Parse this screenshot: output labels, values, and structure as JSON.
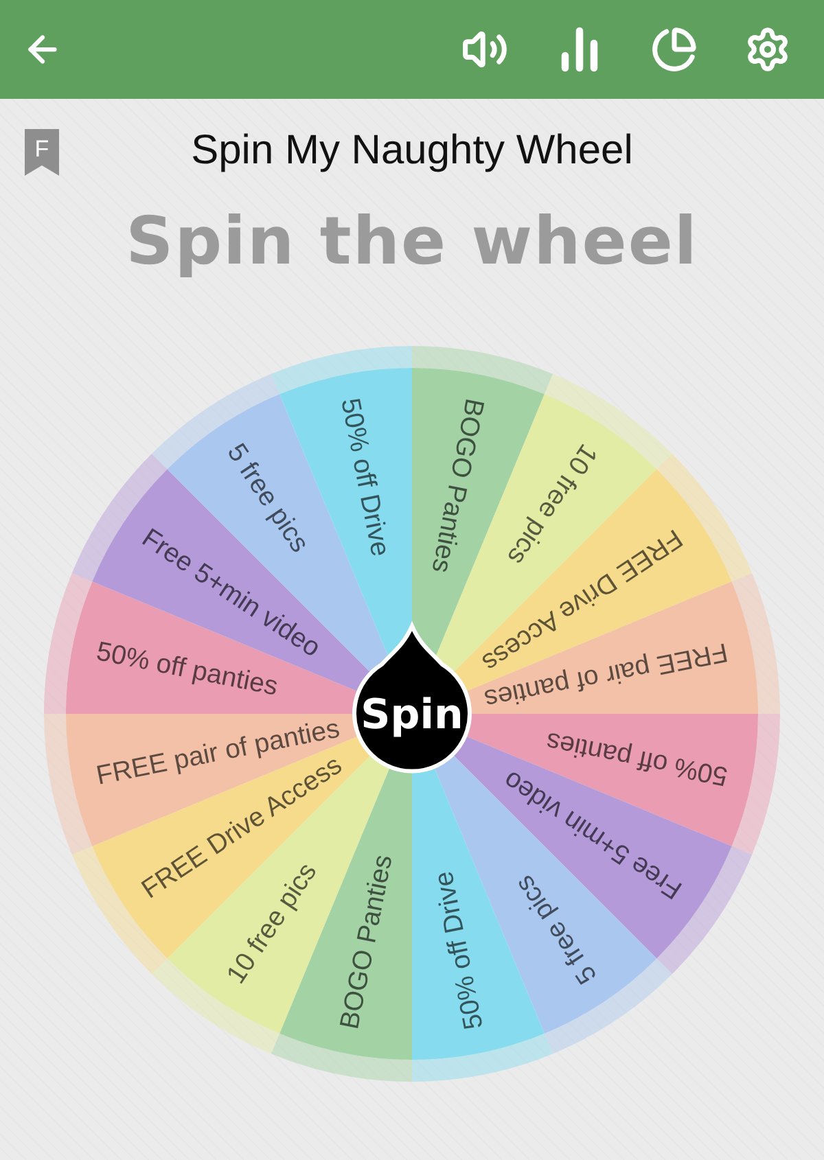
{
  "title": "Spin My Naughty Wheel",
  "badge": "F",
  "heading": "Spin the wheel",
  "spin_button": "Spin",
  "segments": [
    {
      "label": "BOGO Panties",
      "color": "#a3d3a5"
    },
    {
      "label": "10 free pics",
      "color": "#e3eca4"
    },
    {
      "label": "FREE Drive Access",
      "color": "#f6db8c"
    },
    {
      "label": "FREE pair of panties",
      "color": "#f2c1a8"
    },
    {
      "label": "50% off panties",
      "color": "#e99cb2"
    },
    {
      "label": "Free 5+min video",
      "color": "#b49ad9"
    },
    {
      "label": "5 free pics",
      "color": "#a9c7ef"
    },
    {
      "label": "50% off Drive",
      "color": "#86dcee"
    },
    {
      "label": "BOGO Panties",
      "color": "#a3d3a5"
    },
    {
      "label": "10 free pics",
      "color": "#e3eca4"
    },
    {
      "label": "FREE Drive Access",
      "color": "#f6db8c"
    },
    {
      "label": "FREE pair of panties",
      "color": "#f2c1a8"
    },
    {
      "label": "50% off panties",
      "color": "#e99cb2"
    },
    {
      "label": "Free 5+min video",
      "color": "#b49ad9"
    },
    {
      "label": "5 free pics",
      "color": "#a9c7ef"
    },
    {
      "label": "50% off Drive",
      "color": "#86dcee"
    }
  ]
}
